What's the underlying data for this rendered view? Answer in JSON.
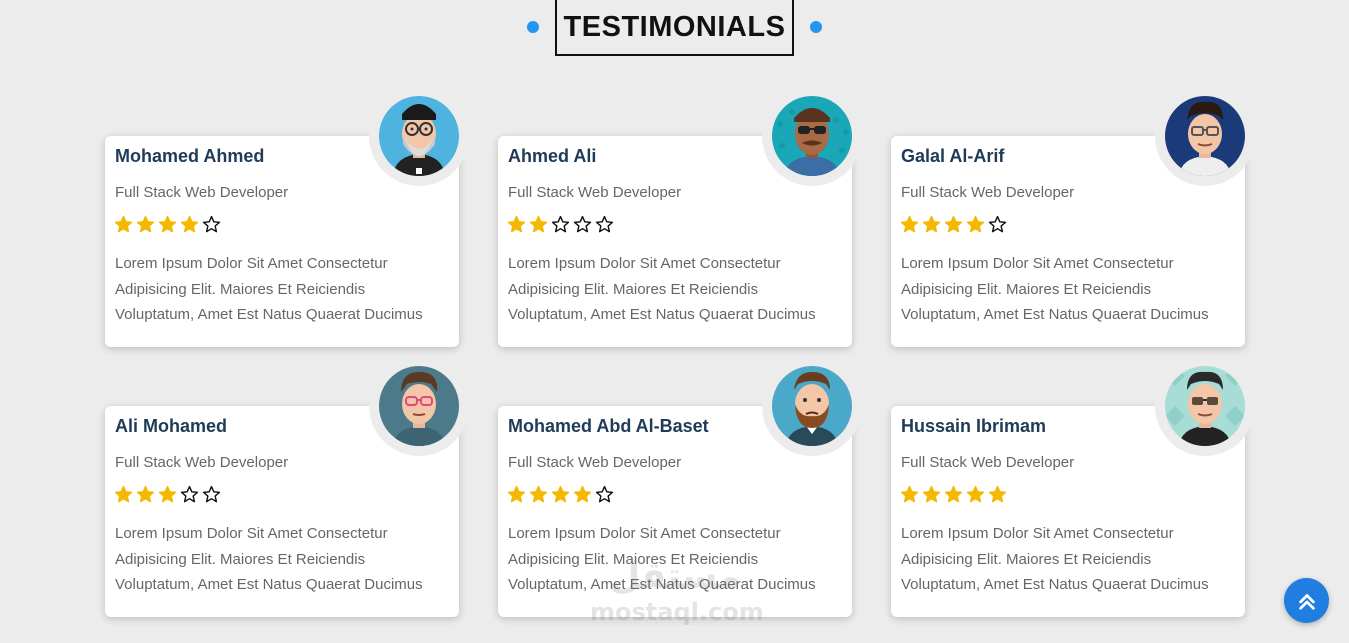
{
  "header": {
    "title": "TESTIMONIALS",
    "accent_color": "#2196f3"
  },
  "testimonials": [
    {
      "name": "Mohamed Ahmed",
      "role": "Full Stack Web Developer",
      "rating": 4,
      "max_rating": 5,
      "text": [
        "Lorem Ipsum Dolor Sit Amet Consectetur",
        "Adipisicing Elit. Maiores Et Reiciendis",
        "Voluptatum, Amet Est Natus Quaerat Ducimus"
      ],
      "avatar_icon": "bearded-man-with-glasses-avatar"
    },
    {
      "name": "Ahmed Ali",
      "role": "Full Stack Web Developer",
      "rating": 2,
      "max_rating": 5,
      "text": [
        "Lorem Ipsum Dolor Sit Amet Consectetur",
        "Adipisicing Elit. Maiores Et Reiciendis",
        "Voluptatum, Amet Est Natus Quaerat Ducimus"
      ],
      "avatar_icon": "man-with-sunglasses-avatar"
    },
    {
      "name": "Galal Al-Arif",
      "role": "Full Stack Web Developer",
      "rating": 4,
      "max_rating": 5,
      "text": [
        "Lorem Ipsum Dolor Sit Amet Consectetur",
        "Adipisicing Elit. Maiores Et Reiciendis",
        "Voluptatum, Amet Est Natus Quaerat Ducimus"
      ],
      "avatar_icon": "man-with-glasses-avatar"
    },
    {
      "name": "Ali Mohamed",
      "role": "Full Stack Web Developer",
      "rating": 3,
      "max_rating": 5,
      "text": [
        "Lorem Ipsum Dolor Sit Amet Consectetur",
        "Adipisicing Elit. Maiores Et Reiciendis",
        "Voluptatum, Amet Est Natus Quaerat Ducimus"
      ],
      "avatar_icon": "man-with-pink-glasses-avatar"
    },
    {
      "name": "Mohamed Abd Al-Baset",
      "role": "Full Stack Web Developer",
      "rating": 4,
      "max_rating": 5,
      "text": [
        "Lorem Ipsum Dolor Sit Amet Consectetur",
        "Adipisicing Elit. Maiores Et Reiciendis",
        "Voluptatum, Amet Est Natus Quaerat Ducimus"
      ],
      "avatar_icon": "bearded-man-avatar"
    },
    {
      "name": "Hussain Ibrimam",
      "role": "Full Stack Web Developer",
      "rating": 5,
      "max_rating": 5,
      "text": [
        "Lorem Ipsum Dolor Sit Amet Consectetur",
        "Adipisicing Elit. Maiores Et Reiciendis",
        "Voluptatum, Amet Est Natus Quaerat Ducimus"
      ],
      "avatar_icon": "man-with-dark-glasses-avatar"
    }
  ],
  "watermark": {
    "arabic": "مستقل",
    "latin": "mostaql.com"
  },
  "scroll_top": {
    "icon": "double-chevron-up-icon",
    "color": "#1f7ee0"
  },
  "colors": {
    "star_filled": "#f5b800",
    "name_text": "#1f3b57"
  }
}
